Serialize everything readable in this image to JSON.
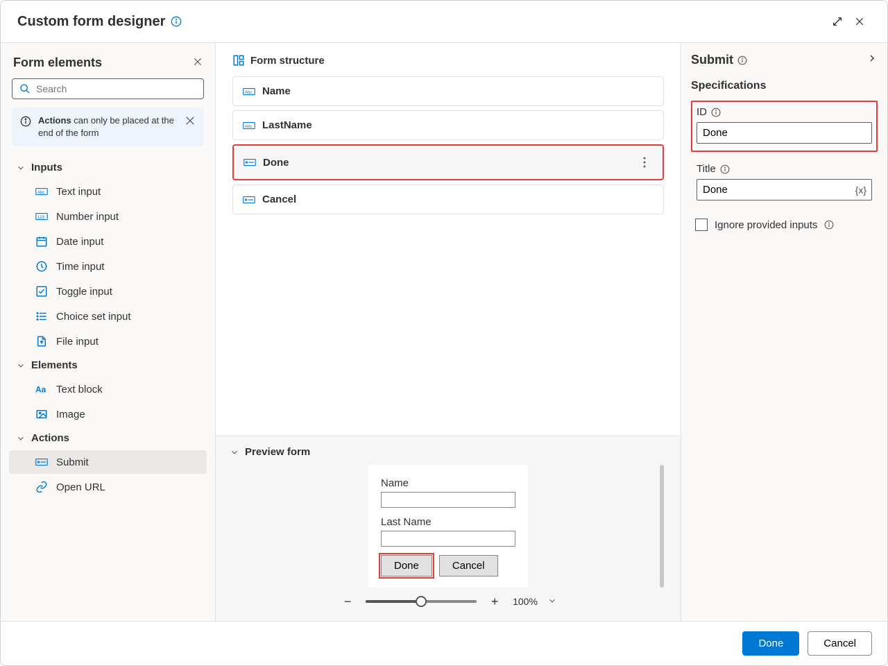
{
  "header": {
    "title": "Custom form designer"
  },
  "sidebar": {
    "title": "Form elements",
    "search_placeholder": "Search",
    "alert_text_pre": "Actions",
    "alert_text_rest": " can only be placed at the end of the form",
    "groups": {
      "inputs": {
        "label": "Inputs",
        "items": [
          {
            "label": "Text input"
          },
          {
            "label": "Number input"
          },
          {
            "label": "Date input"
          },
          {
            "label": "Time input"
          },
          {
            "label": "Toggle input"
          },
          {
            "label": "Choice set input"
          },
          {
            "label": "File input"
          }
        ]
      },
      "elements": {
        "label": "Elements",
        "items": [
          {
            "label": "Text block"
          },
          {
            "label": "Image"
          }
        ]
      },
      "actions": {
        "label": "Actions",
        "items": [
          {
            "label": "Submit"
          },
          {
            "label": "Open URL"
          }
        ]
      }
    }
  },
  "structure": {
    "title": "Form structure",
    "rows": [
      {
        "label": "Name"
      },
      {
        "label": "LastName"
      },
      {
        "label": "Done"
      },
      {
        "label": "Cancel"
      }
    ]
  },
  "preview": {
    "title": "Preview form",
    "fields": [
      {
        "label": "Name"
      },
      {
        "label": "Last Name"
      }
    ],
    "done_label": "Done",
    "cancel_label": "Cancel",
    "zoom_label": "100%"
  },
  "props": {
    "title": "Submit",
    "section": "Specifications",
    "id_label": "ID",
    "id_value": "Done",
    "title_label": "Title",
    "title_value": "Done",
    "fx_token": "{x}",
    "ignore_label": "Ignore provided inputs"
  },
  "footer": {
    "done": "Done",
    "cancel": "Cancel"
  }
}
